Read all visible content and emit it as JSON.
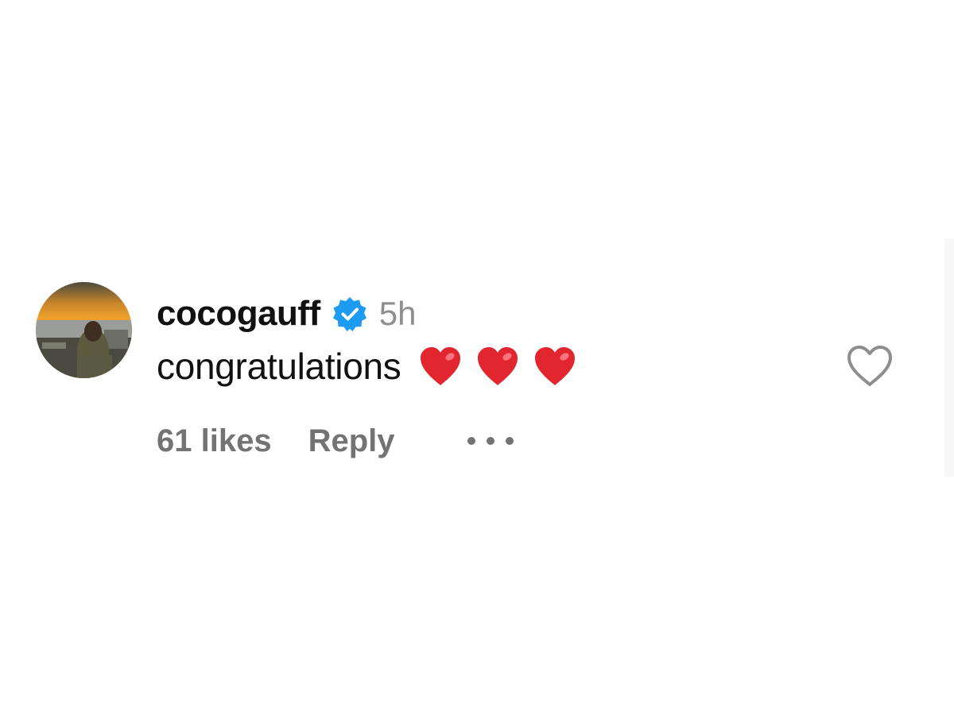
{
  "comment": {
    "username": "cocogauff",
    "verified": true,
    "time": "5h",
    "text": "congratulations",
    "emoji": [
      "red-heart",
      "red-heart",
      "red-heart"
    ],
    "likes_label": "61 likes",
    "reply_label": "Reply"
  },
  "colors": {
    "verified_badge": "#1d9bf0",
    "heart_emoji": "#e2262f",
    "muted_text": "#737373"
  },
  "icons": {
    "verified": "verified-badge-icon",
    "like": "heart-outline-icon",
    "more": "more-options-icon"
  }
}
